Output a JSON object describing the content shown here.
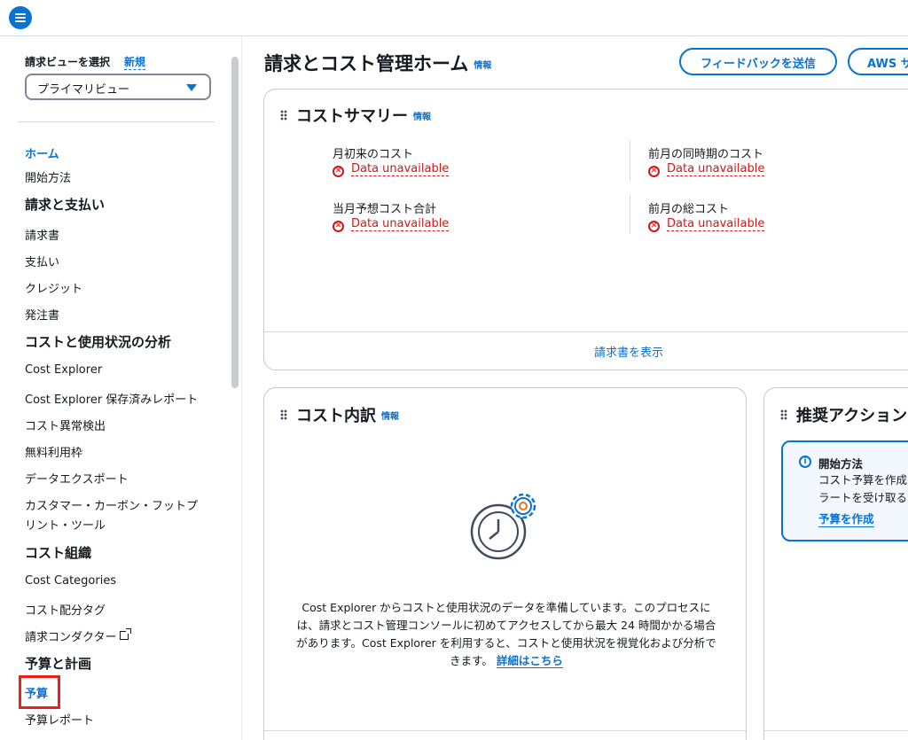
{
  "topbar": {
    "menu_icon": "hamburger-menu-icon"
  },
  "sidebar": {
    "view_label": "請求ビューを選択",
    "view_new": "新規",
    "view_selected": "プライマリビュー",
    "items": [
      {
        "label": "ホーム",
        "type": "item",
        "active": true
      },
      {
        "label": "開始方法",
        "type": "item"
      },
      {
        "label": "請求と支払い",
        "type": "head"
      },
      {
        "label": "請求書",
        "type": "item"
      },
      {
        "label": "支払い",
        "type": "item"
      },
      {
        "label": "クレジット",
        "type": "item"
      },
      {
        "label": "発注書",
        "type": "item"
      },
      {
        "label": "コストと使用状況の分析",
        "type": "head"
      },
      {
        "label": "Cost Explorer",
        "type": "item"
      },
      {
        "label": "Cost Explorer 保存済みレポート",
        "type": "item"
      },
      {
        "label": "コスト異常検出",
        "type": "item"
      },
      {
        "label": "無料利用枠",
        "type": "item"
      },
      {
        "label": "データエクスポート",
        "type": "item"
      },
      {
        "label": "カスタマー・カーボン・フットプ",
        "type": "item"
      },
      {
        "label": "リント・ツール",
        "type": "item"
      },
      {
        "label": "コスト組織",
        "type": "head"
      },
      {
        "label": "Cost Categories",
        "type": "item"
      },
      {
        "label": "コスト配分タグ",
        "type": "item"
      },
      {
        "label": "請求コンダクター",
        "type": "item"
      },
      {
        "label": "予算と計画",
        "type": "head"
      },
      {
        "label": "予算",
        "type": "item",
        "active": true
      },
      {
        "label": "予算レポート",
        "type": "item"
      }
    ]
  },
  "header": {
    "title": "請求とコスト管理ホーム",
    "info": "情報",
    "feedback_button": "フィードバックを送信",
    "aws_button": "AWS サ"
  },
  "cost_summary": {
    "title": "コストサマリー",
    "info": "情報",
    "metrics": [
      {
        "label": "月初来のコスト",
        "value": "Data unavailable"
      },
      {
        "label": "前月の同時期のコスト",
        "value": "Data unavailable"
      },
      {
        "label": "当月予想コスト合計",
        "value": "Data unavailable"
      },
      {
        "label": "前月の総コスト",
        "value": "Data unavailable"
      }
    ],
    "footer_link": "請求書を表示"
  },
  "cost_breakdown": {
    "title": "コスト内訳",
    "info": "情報",
    "illustration": "clock-gear-icon",
    "description": "Cost Explorer からコストと使用状況のデータを準備しています。このプロセスには、請求とコスト管理コンソールに初めてアクセスしてから最大 24 時間かかる場合があります。Cost Explorer を利用すると、コストと使用状況を視覚化および分析できます。",
    "learn_more": "詳細はこちら"
  },
  "recommended": {
    "title": "推奨アクション",
    "alert_title": "開始方法",
    "alert_line1": "コスト予算を作成",
    "alert_line2": "ラートを受け取る",
    "alert_link": "予算を作成"
  },
  "colors": {
    "accent": "#0972d3",
    "error": "#d91515",
    "highlight": "#e8211a"
  }
}
